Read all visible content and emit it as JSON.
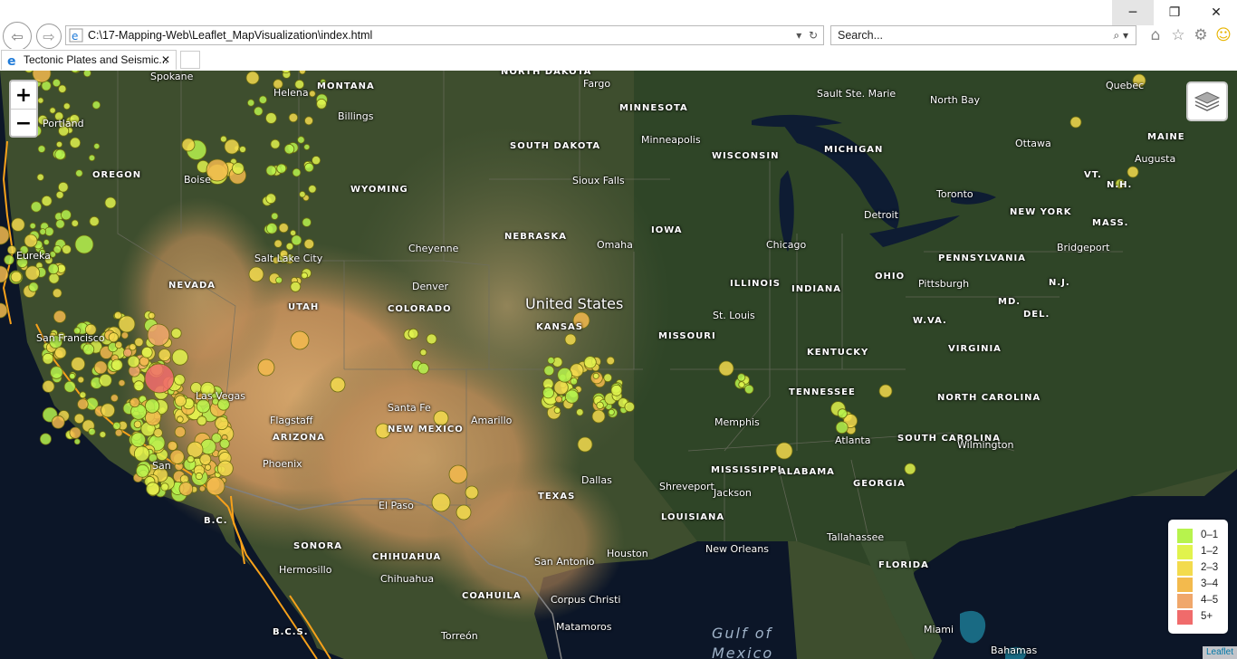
{
  "browser": {
    "url": "C:\\17-Mapping-Web\\Leaflet_MapVisualization\\index.html",
    "search_placeholder": "Search...",
    "tab_title": "Tectonic Plates and Seismic...",
    "win_min": "─",
    "win_max": "❐",
    "win_close": "✕",
    "back": "⇦",
    "forward": "⇨",
    "tab_close": "✕",
    "toolbar_icons": [
      "home-icon",
      "star-icon",
      "gear-icon",
      "smiley-icon"
    ]
  },
  "map": {
    "zoom_in": "+",
    "zoom_out": "−",
    "attribution": "Leaflet",
    "country_label": "United States",
    "water_label_1": "Gulf of",
    "water_label_2": "Mexico",
    "states": [
      "MONTANA",
      "NORTH DAKOTA",
      "MINNESOTA",
      "SOUTH DAKOTA",
      "WISCONSIN",
      "MICHIGAN",
      "OREGON",
      "WYOMING",
      "IOWA",
      "NEBRASKA",
      "NEVADA",
      "COLORADO",
      "KANSAS",
      "MISSOURI",
      "ILLINOIS",
      "INDIANA",
      "OHIO",
      "PENNSYLVANIA",
      "NEW YORK",
      "VT.",
      "N.H.",
      "MASS.",
      "MAINE",
      "N.J.",
      "MD.",
      "DEL.",
      "W.VA.",
      "VIRGINIA",
      "KENTUCKY",
      "TENNESSEE",
      "NORTH CAROLINA",
      "SOUTH CAROLINA",
      "GEORGIA",
      "ALABAMA",
      "MISSISSIPPI",
      "LOUISIANA",
      "TEXAS",
      "NEW MEXICO",
      "ARIZONA",
      "FLORIDA",
      "SONORA",
      "CHIHUAHUA",
      "COAHUILA",
      "B.C.",
      "B.C.S.",
      "UTAH"
    ],
    "cities": [
      "Spokane",
      "Boise",
      "Billings",
      "Helena",
      "Portland",
      "Eureka",
      "Fargo",
      "Minneapolis",
      "Sioux Falls",
      "Sault Ste. Marie",
      "North Bay",
      "Quebec",
      "Ottawa",
      "Augusta",
      "Toronto",
      "Bridgeport",
      "Detroit",
      "Chicago",
      "Omaha",
      "Cheyenne",
      "Salt Lake City",
      "Denver",
      "St. Louis",
      "Pittsburgh",
      "San Francisco",
      "Las Vegas",
      "Santa Fe",
      "Flagstaff",
      "Phoenix",
      "Amarillo",
      "Memphis",
      "Atlanta",
      "Wilmington",
      "Dallas",
      "Shreveport",
      "Jackson",
      "El Paso",
      "San Antonio",
      "Houston",
      "New Orleans",
      "Tallahassee",
      "Hermosillo",
      "Chihuahua",
      "Corpus Christi",
      "Matamoros",
      "Torreón",
      "Miami",
      "Bahamas",
      "San"
    ],
    "legend": [
      {
        "label": "0–1",
        "color": "#b7f34d"
      },
      {
        "label": "1–2",
        "color": "#e1f34d"
      },
      {
        "label": "2–3",
        "color": "#f3db4d"
      },
      {
        "label": "3–4",
        "color": "#f3ba4d"
      },
      {
        "label": "4–5",
        "color": "#f0a76b"
      },
      {
        "label": "5+",
        "color": "#f06b6b"
      }
    ],
    "overlay_colors": {
      "plate_boundary": "#f7a11a",
      "land": "#4a5a36",
      "desert": "#c89a62",
      "water": "#0c1628"
    }
  }
}
